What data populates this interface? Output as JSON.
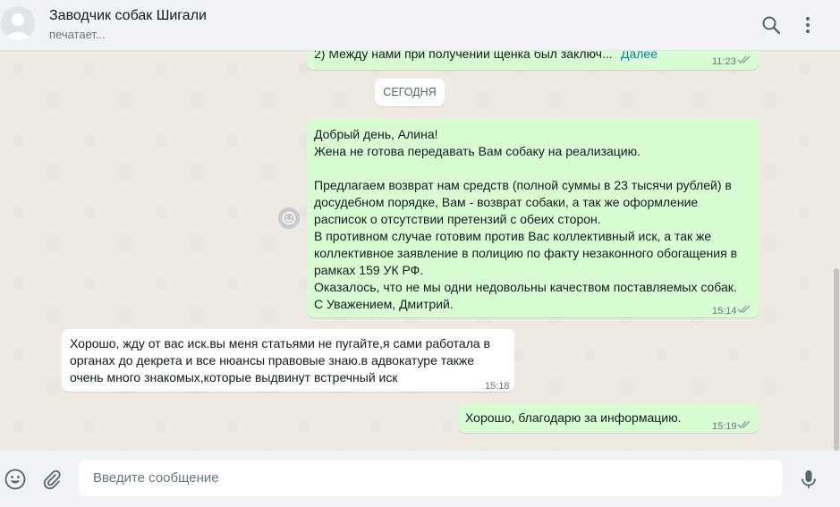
{
  "header": {
    "contact_name": "Заводчик собак Шигали",
    "status": "печатает..."
  },
  "chat": {
    "prev_message": {
      "text": "2) Между нами при получении щенка был заключ...",
      "more_label": "Далее",
      "time": "11:23"
    },
    "date_divider": "СЕГОДНЯ",
    "message_1": {
      "lines": [
        "Добрый день, Алина!",
        "Жена не готова передавать Вам собаку на реализацию.",
        "",
        "Предлагаем возврат нам средств (полной суммы в 23 тысячи рублей) в",
        "досудебном порядке, Вам - возврат собаки, а так же оформление",
        "расписок о отсутствии претензий с обеих сторон.",
        "В противном случае готовим против Вас коллективный иск, а так же",
        "коллективное заявление в полицию по факту незаконного обогащения в",
        "рамках 159 УК РФ.",
        "Оказалось, что не мы одни недовольны качеством поставляемых собак.",
        "С Уважением, Дмитрий."
      ],
      "time": "15:14"
    },
    "message_2": {
      "lines": [
        "Хорошо, жду от вас иск.вы меня статьями не пугайте,я сами работала в",
        "органах до декрета и все нюансы правовые знаю.в адвокатуре также",
        "очень много знакомых,которые выдвинут встречный иск"
      ],
      "time": "15:18"
    },
    "message_3": {
      "text": "Хорошо, благодарю за информацию.",
      "time": "15:19"
    }
  },
  "composer": {
    "placeholder": "Введите сообщение"
  },
  "colors": {
    "outgoing_bubble": "#d9fdd3",
    "incoming_bubble": "#ffffff",
    "chat_background": "#efeae2",
    "link": "#027eb5",
    "read_ticks": "#8696a0"
  },
  "icons": [
    "avatar-placeholder-icon",
    "search-icon",
    "menu-dots-icon",
    "read-ticks-icon",
    "reaction-smiley-icon",
    "emoji-icon",
    "attach-icon",
    "microphone-icon"
  ]
}
